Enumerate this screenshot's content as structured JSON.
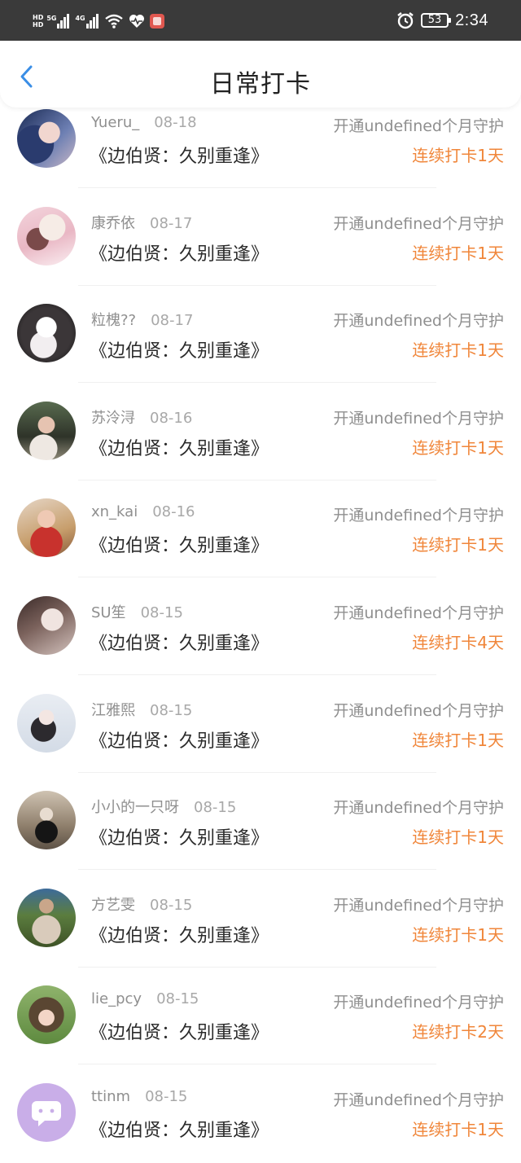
{
  "status_bar": {
    "hd1": "HD",
    "hd2": "HD",
    "net1": "5G",
    "net2": "4G",
    "battery": "53",
    "time": "2:34"
  },
  "header": {
    "title": "日常打卡",
    "back_icon": "chevron-left-icon",
    "back_color": "#3a8ee6"
  },
  "colors": {
    "accent_orange": "#f0863a",
    "meta_gray": "#8f8f8f",
    "text_dark": "#2b2b2b"
  },
  "rows": [
    {
      "name": "Yueru_",
      "date": "08-18",
      "book": "《边伯贤：久别重逢》",
      "guard": "开通undefined个月守护",
      "streak": "连续打卡1天"
    },
    {
      "name": "康乔依",
      "date": "08-17",
      "book": "《边伯贤：久别重逢》",
      "guard": "开通undefined个月守护",
      "streak": "连续打卡1天"
    },
    {
      "name": "粒槐??",
      "date": "08-17",
      "book": "《边伯贤：久别重逢》",
      "guard": "开通undefined个月守护",
      "streak": "连续打卡1天"
    },
    {
      "name": "苏泠浔",
      "date": "08-16",
      "book": "《边伯贤：久别重逢》",
      "guard": "开通undefined个月守护",
      "streak": "连续打卡1天"
    },
    {
      "name": "xn_kai",
      "date": "08-16",
      "book": "《边伯贤：久别重逢》",
      "guard": "开通undefined个月守护",
      "streak": "连续打卡1天"
    },
    {
      "name": "SU笙",
      "date": "08-15",
      "book": "《边伯贤：久别重逢》",
      "guard": "开通undefined个月守护",
      "streak": "连续打卡4天"
    },
    {
      "name": "江雅熙",
      "date": "08-15",
      "book": "《边伯贤：久别重逢》",
      "guard": "开通undefined个月守护",
      "streak": "连续打卡1天"
    },
    {
      "name": "小小的一只呀",
      "date": "08-15",
      "book": "《边伯贤：久别重逢》",
      "guard": "开通undefined个月守护",
      "streak": "连续打卡1天"
    },
    {
      "name": "方艺雯",
      "date": "08-15",
      "book": "《边伯贤：久别重逢》",
      "guard": "开通undefined个月守护",
      "streak": "连续打卡1天"
    },
    {
      "name": "lie_pcy",
      "date": "08-15",
      "book": "《边伯贤：久别重逢》",
      "guard": "开通undefined个月守护",
      "streak": "连续打卡2天"
    },
    {
      "name": "ttinm",
      "date": "08-15",
      "book": "《边伯贤：久别重逢》",
      "guard": "开通undefined个月守护",
      "streak": "连续打卡1天"
    }
  ]
}
